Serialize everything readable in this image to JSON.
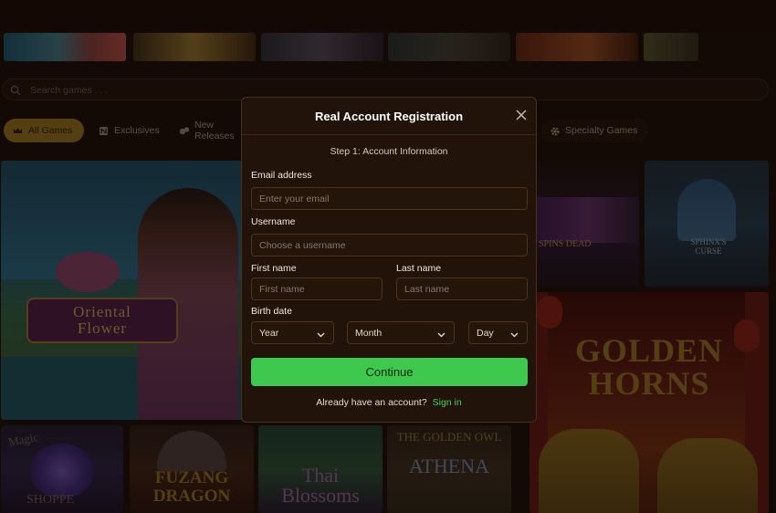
{
  "search": {
    "placeholder": "Search games . . ."
  },
  "categories": [
    {
      "label": "All Games",
      "active": true,
      "icon": "crown-icon"
    },
    {
      "label": "Exclusives",
      "active": false,
      "icon": "ribbon-icon"
    },
    {
      "label": "New Releases",
      "active": false,
      "icon": "sparkle-icon"
    },
    {
      "label": "Specialty Games",
      "active": false,
      "icon": "gear-icon"
    }
  ],
  "games": {
    "oriental": {
      "line1": "Oriental",
      "line2": "Flower"
    },
    "spins": {
      "label": "SPINS DEAD"
    },
    "sphinx": {
      "line1": "SPHINX'S",
      "line2": "CURSE"
    },
    "golden": {
      "line1": "GOLDEN",
      "line2": "HORNS"
    },
    "magic": {
      "line1": "Magic",
      "line2": "SHOPPE"
    },
    "fuzang": {
      "line1": "FUZANG",
      "line2": "DRAGON"
    },
    "thai": {
      "line1": "Thai",
      "line2": "Blossoms"
    },
    "owl": {
      "line1": "THE GOLDEN OWL",
      "line2": "ATHENA"
    }
  },
  "modal": {
    "title": "Real Account Registration",
    "step": "Step 1: Account Information",
    "email": {
      "label": "Email address",
      "placeholder": "Enter your email"
    },
    "username": {
      "label": "Username",
      "placeholder": "Choose a username"
    },
    "first_name": {
      "label": "First name",
      "placeholder": "First name"
    },
    "last_name": {
      "label": "Last name",
      "placeholder": "Last name"
    },
    "birth_date": {
      "label": "Birth date",
      "year": "Year",
      "month": "Month",
      "day": "Day"
    },
    "continue_label": "Continue",
    "signin_prompt": "Already have an account?",
    "signin_link": "Sign in"
  },
  "colors": {
    "accent_green": "#3ec84e",
    "active_tab": "#8a6a1a",
    "modal_bg": "#211309"
  }
}
